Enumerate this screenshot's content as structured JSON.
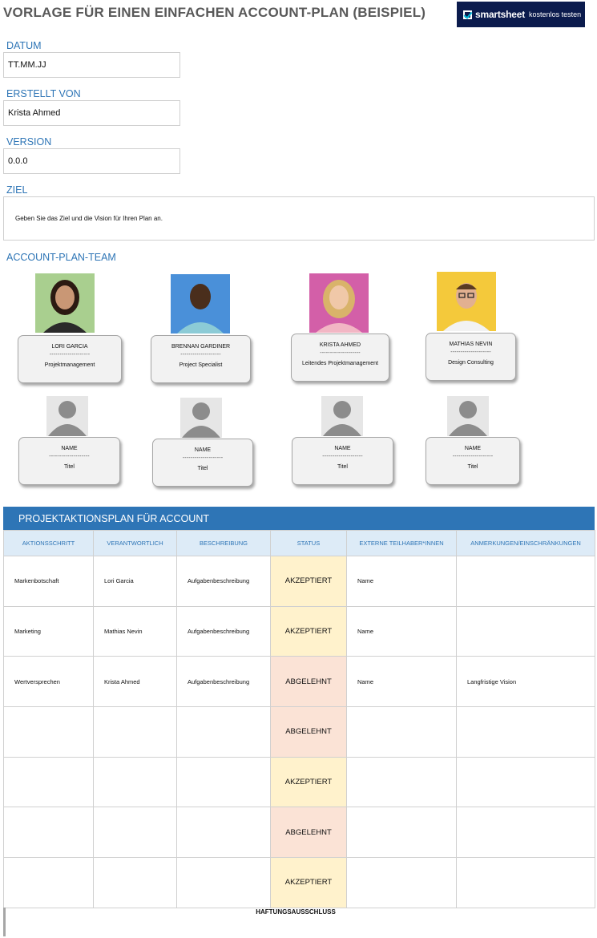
{
  "title": "VORLAGE FÜR EINEN EINFACHEN ACCOUNT-PLAN (BEISPIEL)",
  "brand": {
    "name": "smartsheet",
    "cta": "kostenlos testen",
    "bg": "#0b1b4d"
  },
  "fields": {
    "date_label": "DATUM",
    "date_value": "TT.MM.JJ",
    "author_label": "ERSTELLT VON",
    "author_value": "Krista Ahmed",
    "version_label": "VERSION",
    "version_value": "0.0.0",
    "goal_label": "ZIEL",
    "goal_value": "Geben Sie das Ziel und die Vision für Ihren Plan an."
  },
  "team": {
    "label": "ACCOUNT-PLAN-TEAM",
    "separator": "--------------------",
    "members": [
      {
        "name": "LORI GARCIA",
        "role": "Projektmanagement",
        "photo_bg": "#a9cf8f"
      },
      {
        "name": "BRENNAN GARDINER",
        "role": "Project Specialist",
        "photo_bg": "#4a90d9"
      },
      {
        "name": "KRISTA AHMED",
        "role": "Leitendes Projektmanagement",
        "photo_bg": "#d35fa8"
      },
      {
        "name": "MATHIAS NEVIN",
        "role": "Design Consulting",
        "photo_bg": "#f4c93b"
      }
    ],
    "placeholders": [
      {
        "name": "NAME",
        "role": "Titel"
      },
      {
        "name": "NAME",
        "role": "Titel"
      },
      {
        "name": "NAME",
        "role": "Titel"
      },
      {
        "name": "NAME",
        "role": "Titel"
      }
    ]
  },
  "plan": {
    "title": "PROJEKTAKTIONSPLAN FÜR ACCOUNT",
    "columns": [
      "AKTIONSSCHRITT",
      "VERANTWORTLICH",
      "BESCHREIBUNG",
      "STATUS",
      "EXTERNE TEILHABER*INNEN",
      "ANMERKUNGEN/EINSCHRÄNKUNGEN"
    ],
    "rows": [
      {
        "step": "Markenbotschaft",
        "owner": "Lori Garcia",
        "desc": "Aufgabenbeschreibung",
        "status": "AKZEPTIERT",
        "stakeholders": "Name",
        "notes": ""
      },
      {
        "step": "Marketing",
        "owner": "Mathias Nevin",
        "desc": "Aufgabenbeschreibung",
        "status": "AKZEPTIERT",
        "stakeholders": "Name",
        "notes": ""
      },
      {
        "step": "Wertversprechen",
        "owner": "Krista Ahmed",
        "desc": "Aufgabenbeschreibung",
        "status": "ABGELEHNT",
        "stakeholders": "Name",
        "notes": "Langfristige Vision"
      },
      {
        "step": "",
        "owner": "",
        "desc": "",
        "status": "ABGELEHNT",
        "stakeholders": "",
        "notes": ""
      },
      {
        "step": "",
        "owner": "",
        "desc": "",
        "status": "AKZEPTIERT",
        "stakeholders": "",
        "notes": ""
      },
      {
        "step": "",
        "owner": "",
        "desc": "",
        "status": "ABGELEHNT",
        "stakeholders": "",
        "notes": ""
      },
      {
        "step": "",
        "owner": "",
        "desc": "",
        "status": "AKZEPTIERT",
        "stakeholders": "",
        "notes": ""
      }
    ]
  },
  "status_colors": {
    "AKZEPTIERT": "#fff2cc",
    "ABGELEHNT": "#fbe3d6"
  },
  "disclaimer": "HAFTUNGSAUSSCHLUSS"
}
